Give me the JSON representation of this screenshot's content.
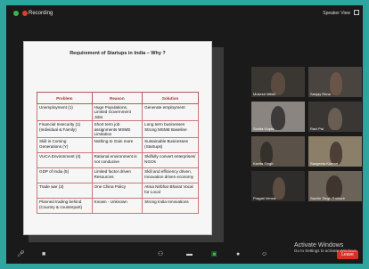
{
  "topbar": {
    "recording_label": "Recording",
    "speaker_view_label": "Speaker View"
  },
  "slide": {
    "title": "Requirement of Startups in India – Why ?",
    "headers": [
      "Problem",
      "Reason",
      "Solution"
    ],
    "rows": [
      [
        "Unemployment (1)",
        "Huge Populations, Limited Government Jobs",
        "Generate employment"
      ],
      [
        "Financial Insecurity (1) (Individual & Family)",
        "Short term job assignments MSME Limitation",
        "Long term businesses Strong MSME Baseline"
      ],
      [
        "Skill in Coming Generations (Y)",
        "Nothing to Gain more",
        "Sustainable Businesses (Startups)"
      ],
      [
        "VUCA Environment (4)",
        "Rational environment is not conducive",
        "Skilfully convert enterprises/ NGOs"
      ],
      [
        "GDP of India (5)",
        "Limited factor driven Resources",
        "Skill and efficiency driven, Innovation driven economy"
      ],
      [
        "Trade war (3)",
        "One China Policy",
        "Atma Nirbhar Bharat Vocal for Local"
      ],
      [
        "Planned trading behind (Country & counterpart)",
        "Known - Unknown",
        "Strong India Innovations"
      ]
    ]
  },
  "participants": [
    {
      "name": "Mukesh Mittal"
    },
    {
      "name": "Sanjay Rana"
    },
    {
      "name": "Sunita Gupta"
    },
    {
      "name": "Ravi Pal"
    },
    {
      "name": "Kavita Singh"
    },
    {
      "name": "Sangeeta Kumari"
    },
    {
      "name": "Pragati Verma"
    },
    {
      "name": "Sachin Singh Rathore"
    }
  ],
  "controls": {
    "leave_label": "Leave"
  },
  "watermark": {
    "line1": "Activate Windows",
    "line2": "Go to Settings to activate Windows."
  },
  "colors": {
    "frame": "#2fa59f",
    "window": "#1a1a1a",
    "leave": "#d92f26"
  }
}
